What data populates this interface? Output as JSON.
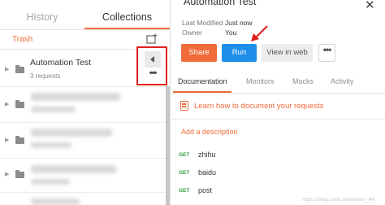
{
  "sidebar": {
    "tabs": [
      {
        "label": "History",
        "active": false
      },
      {
        "label": "Collections",
        "active": true
      }
    ],
    "trash_label": "Trash",
    "collection": {
      "name": "Automation Test",
      "requests_count": "3 requests"
    },
    "more_label": "•••"
  },
  "panel": {
    "title": "Automation Test",
    "close_glyph": "✕",
    "meta": [
      {
        "label": "Last Modified",
        "value": "Just now"
      },
      {
        "label": "Owner",
        "value": "You"
      }
    ],
    "buttons": {
      "share": "Share",
      "run": "Run",
      "view_in_web": "View in web",
      "more": "•••"
    },
    "tabs": [
      {
        "label": "Documentation",
        "active": true
      },
      {
        "label": "Monitors",
        "active": false
      },
      {
        "label": "Mocks",
        "active": false
      },
      {
        "label": "Activity",
        "active": false
      }
    ],
    "learn_link": "Learn how to document your requests",
    "add_description": "Add a description",
    "requests": [
      {
        "method": "GET",
        "name": "zhihu"
      },
      {
        "method": "GET",
        "name": "baidu"
      },
      {
        "method": "GET",
        "name": "post"
      }
    ]
  },
  "watermark": "https://blog.csdn.net/weixin_44..",
  "colors": {
    "accent": "#f26b3a",
    "run_blue": "#1e8ee8",
    "highlight_red": "#e02020",
    "get_green": "#2e9c3f"
  }
}
